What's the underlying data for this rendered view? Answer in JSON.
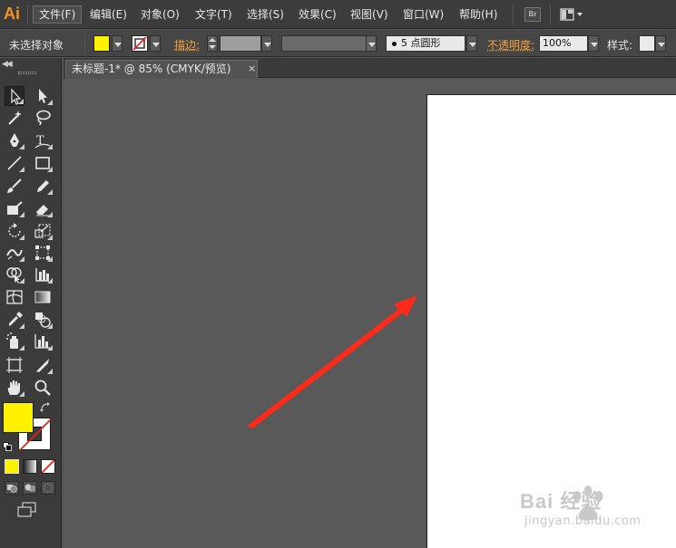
{
  "app": {
    "logo": "Ai"
  },
  "menu": {
    "items": [
      {
        "label": "文件(F)"
      },
      {
        "label": "编辑(E)"
      },
      {
        "label": "对象(O)"
      },
      {
        "label": "文字(T)"
      },
      {
        "label": "选择(S)"
      },
      {
        "label": "效果(C)"
      },
      {
        "label": "视图(V)"
      },
      {
        "label": "窗口(W)"
      },
      {
        "label": "帮助(H)"
      }
    ],
    "bridge_label": "Br"
  },
  "control_bar": {
    "selection_status": "未选择对象",
    "stroke_label": "描边:",
    "brush_value": "5 点圆形",
    "opacity_label": "不透明度:",
    "opacity_value": "100%",
    "style_label": "样式:"
  },
  "document": {
    "tab_title": "未标题-1* @ 85% (CMYK/预览)",
    "close_glyph": "×"
  },
  "colors": {
    "fill": "#fff200",
    "stroke": "none",
    "annotation_arrow": "#ff2a1a"
  },
  "watermark": {
    "brand": "Bai 经验",
    "url": "jingyan.baidu.com"
  }
}
